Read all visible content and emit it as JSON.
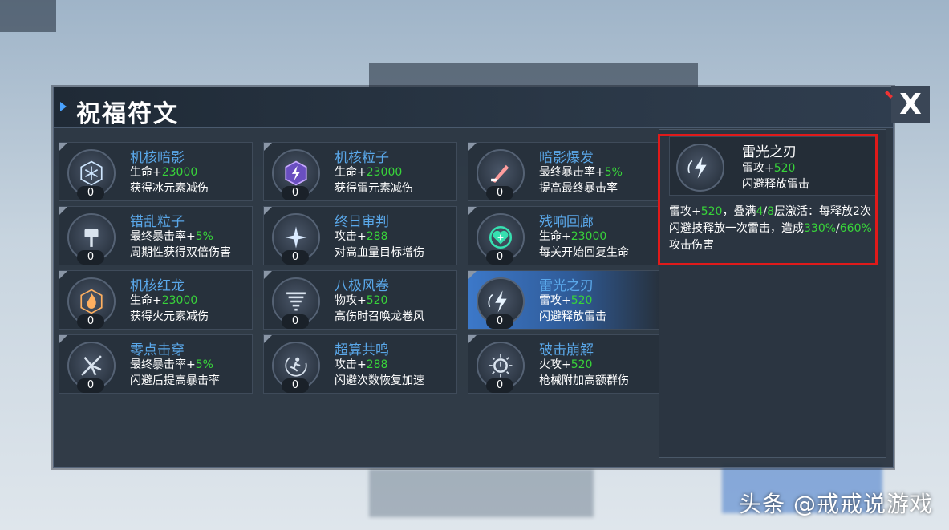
{
  "panel": {
    "title": "祝福符文",
    "close_icon": "close-x-icon"
  },
  "cards": [
    {
      "name": "机核暗影",
      "l1_prefix": "生命+",
      "l1_value": "23000",
      "l1_suffix": "",
      "l2": "获得冰元素减伤",
      "count": "0",
      "icon": "snowflake-icon",
      "icon_color": "#cfe7ff"
    },
    {
      "name": "机核粒子",
      "l1_prefix": "生命+",
      "l1_value": "23000",
      "l1_suffix": "",
      "l2": "获得雷元素减伤",
      "count": "0",
      "icon": "lightning-hex-icon",
      "icon_color": "#c7a8ff"
    },
    {
      "name": "暗影爆发",
      "l1_prefix": "最终暴击率+",
      "l1_value": "5",
      "l1_suffix": "%",
      "l2": "提高最终暴击率",
      "count": "0",
      "icon": "dagger-icon",
      "icon_color": "#ff9e9e"
    },
    {
      "name": "错乱粒子",
      "l1_prefix": "最终暴击率+",
      "l1_value": "5",
      "l1_suffix": "%",
      "l2": "周期性获得双倍伤害",
      "count": "0",
      "icon": "hammer-icon",
      "icon_color": "#d9e3ee"
    },
    {
      "name": "终日审判",
      "l1_prefix": "攻击+",
      "l1_value": "288",
      "l1_suffix": "",
      "l2": "对高血量目标增伤",
      "count": "0",
      "icon": "star-burst-icon",
      "icon_color": "#d9eaff"
    },
    {
      "name": "残响回廊",
      "l1_prefix": "生命+",
      "l1_value": "23000",
      "l1_suffix": "",
      "l2": "每关开始回复生命",
      "count": "0",
      "icon": "heart-plus-icon",
      "icon_color": "#36e0b0"
    },
    {
      "name": "机核红龙",
      "l1_prefix": "生命+",
      "l1_value": "23000",
      "l1_suffix": "",
      "l2": "获得火元素减伤",
      "count": "0",
      "icon": "flame-icon",
      "icon_color": "#ffb060"
    },
    {
      "name": "八极风卷",
      "l1_prefix": "物攻+",
      "l1_value": "520",
      "l1_suffix": "",
      "l2": "高伤时召唤龙卷风",
      "count": "0",
      "icon": "tornado-icon",
      "icon_color": "#d9e3ee"
    },
    {
      "name": "雷光之刃",
      "l1_prefix": "雷攻+",
      "l1_value": "520",
      "l1_suffix": "",
      "l2": "闪避释放雷击",
      "count": "0",
      "icon": "lightning-blade-icon",
      "icon_color": "#e8f4ff",
      "selected": true
    },
    {
      "name": "零点击穿",
      "l1_prefix": "最终暴击率+",
      "l1_value": "5",
      "l1_suffix": "%",
      "l2": "闪避后提高暴击率",
      "count": "0",
      "icon": "shatter-icon",
      "icon_color": "#d9e3ee"
    },
    {
      "name": "超算共鸣",
      "l1_prefix": "攻击+",
      "l1_value": "288",
      "l1_suffix": "",
      "l2": "闪避次数恢复加速",
      "count": "0",
      "icon": "runner-icon",
      "icon_color": "#d9e3ee"
    },
    {
      "name": "破击崩解",
      "l1_prefix": "火攻+",
      "l1_value": "520",
      "l1_suffix": "",
      "l2": "枪械附加高额群伤",
      "count": "0",
      "icon": "burst-ring-icon",
      "icon_color": "#d9e3ee"
    }
  ],
  "detail": {
    "name": "雷光之刃",
    "l1_prefix": "雷攻+",
    "l1_value": "520",
    "l2": "闪避释放雷击",
    "icon": "lightning-blade-icon",
    "desc_parts": [
      {
        "t": "雷攻+",
        "g": false
      },
      {
        "t": "520",
        "g": true
      },
      {
        "t": "，叠满",
        "g": false
      },
      {
        "t": "4",
        "g": true
      },
      {
        "t": "/",
        "g": false
      },
      {
        "t": "8",
        "g": true
      },
      {
        "t": "层激活：每释放2次闪避技释放一次雷击，造成",
        "g": false
      },
      {
        "t": "330%",
        "g": true
      },
      {
        "t": "/",
        "g": false
      },
      {
        "t": "660%",
        "g": true
      },
      {
        "t": "攻击伤害",
        "g": false
      }
    ]
  },
  "watermark": "头条 @戒戒说游戏",
  "accent_red": "#e01a1a",
  "value_green": "#38d43a"
}
